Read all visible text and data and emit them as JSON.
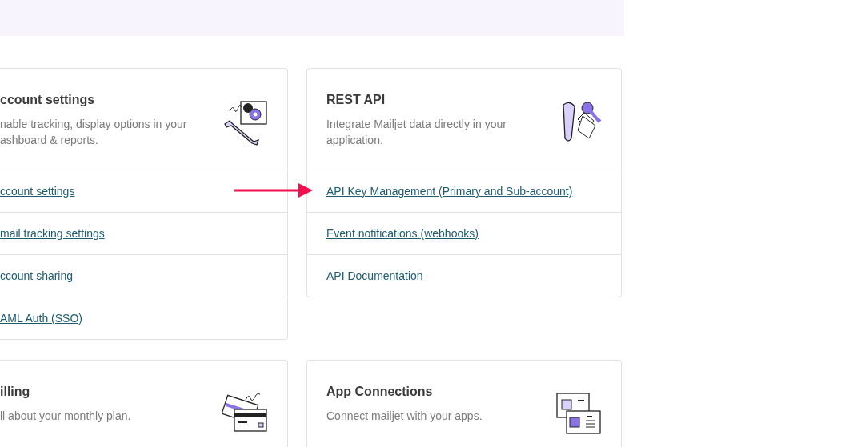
{
  "cards": [
    {
      "kind": "settings",
      "cut_left": true,
      "title": "ccount settings",
      "description": "nable tracking, display options in your ashboard & reports.",
      "links": [
        "ccount settings",
        "mail tracking settings",
        "ccount sharing",
        "AML Auth (SSO)"
      ]
    },
    {
      "kind": "api",
      "cut_left": false,
      "title": "REST API",
      "description": "Integrate Mailjet data directly in your application.",
      "links": [
        "API Key Management (Primary and Sub-account)",
        "Event notifications (webhooks)",
        "API Documentation"
      ]
    },
    {
      "kind": "billing",
      "cut_left": true,
      "title": "illing",
      "description": "ll about your monthly plan."
    },
    {
      "kind": "apps",
      "cut_left": false,
      "title": "App Connections",
      "description": "Connect mailjet with your apps."
    }
  ]
}
